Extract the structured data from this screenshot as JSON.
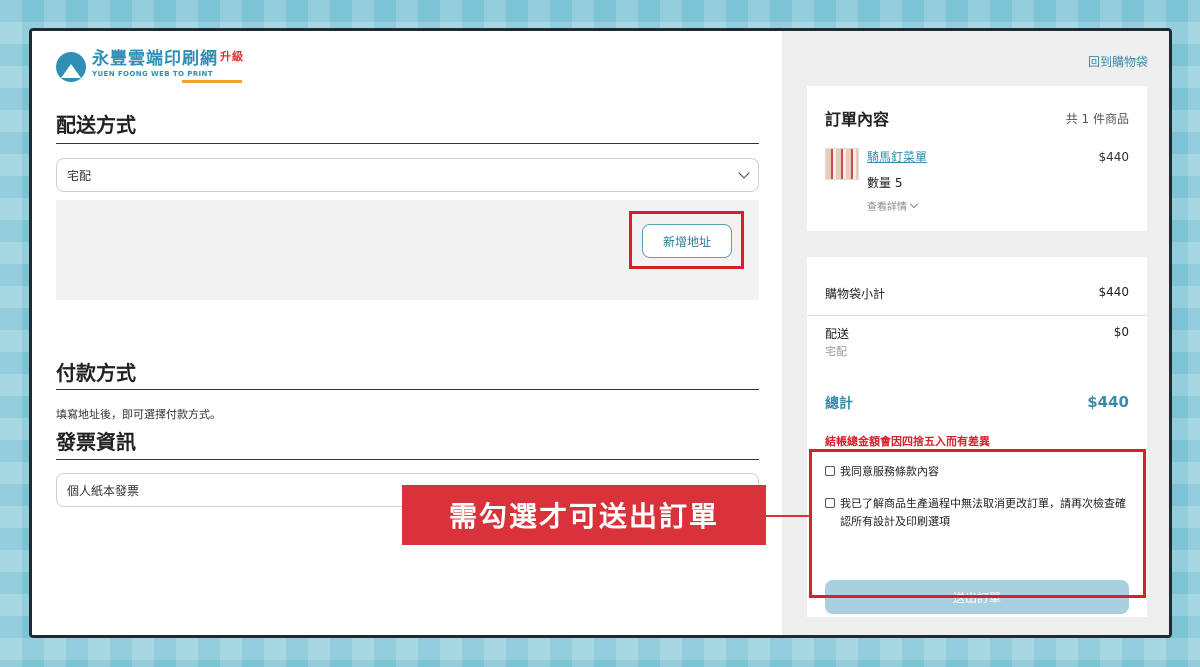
{
  "brand": {
    "logo_main": "永豐雲端印刷網",
    "logo_badge": "升級",
    "logo_sub": "YUEN FOONG WEB TO PRINT"
  },
  "delivery": {
    "title": "配送方式",
    "selected": "宅配",
    "add_address_label": "新增地址"
  },
  "payment": {
    "title": "付款方式",
    "hint": "填寫地址後，即可選擇付款方式。"
  },
  "invoice": {
    "title": "發票資訊",
    "selected": "個人紙本發票"
  },
  "cart": {
    "back_link": "回到購物袋",
    "order_title": "訂單內容",
    "item_count": "共 1 件商品",
    "product": {
      "name": "騎馬釘菜單",
      "price": "$440",
      "quantity": "數量 5",
      "detail_link": "查看詳情"
    }
  },
  "summary": {
    "subtotal_label": "購物袋小計",
    "subtotal_value": "$440",
    "shipping_label": "配送",
    "shipping_value": "$0",
    "shipping_method": "宅配",
    "total_label": "總計",
    "total_value": "$440",
    "rounding_note": "結帳總金額會因四捨五入而有差異",
    "agree_terms": "我同意服務條款內容",
    "agree_production": "我已了解商品生產過程中無法取消更改訂單，請再次檢查確認所有設計及印刷選項",
    "submit_label": "送出訂單"
  },
  "annotation": {
    "callout": "需勾選才可送出訂單"
  },
  "colors": {
    "accent": "#3a8aa8",
    "highlight": "#d6202e",
    "submit_disabled": "#a8d0de"
  }
}
